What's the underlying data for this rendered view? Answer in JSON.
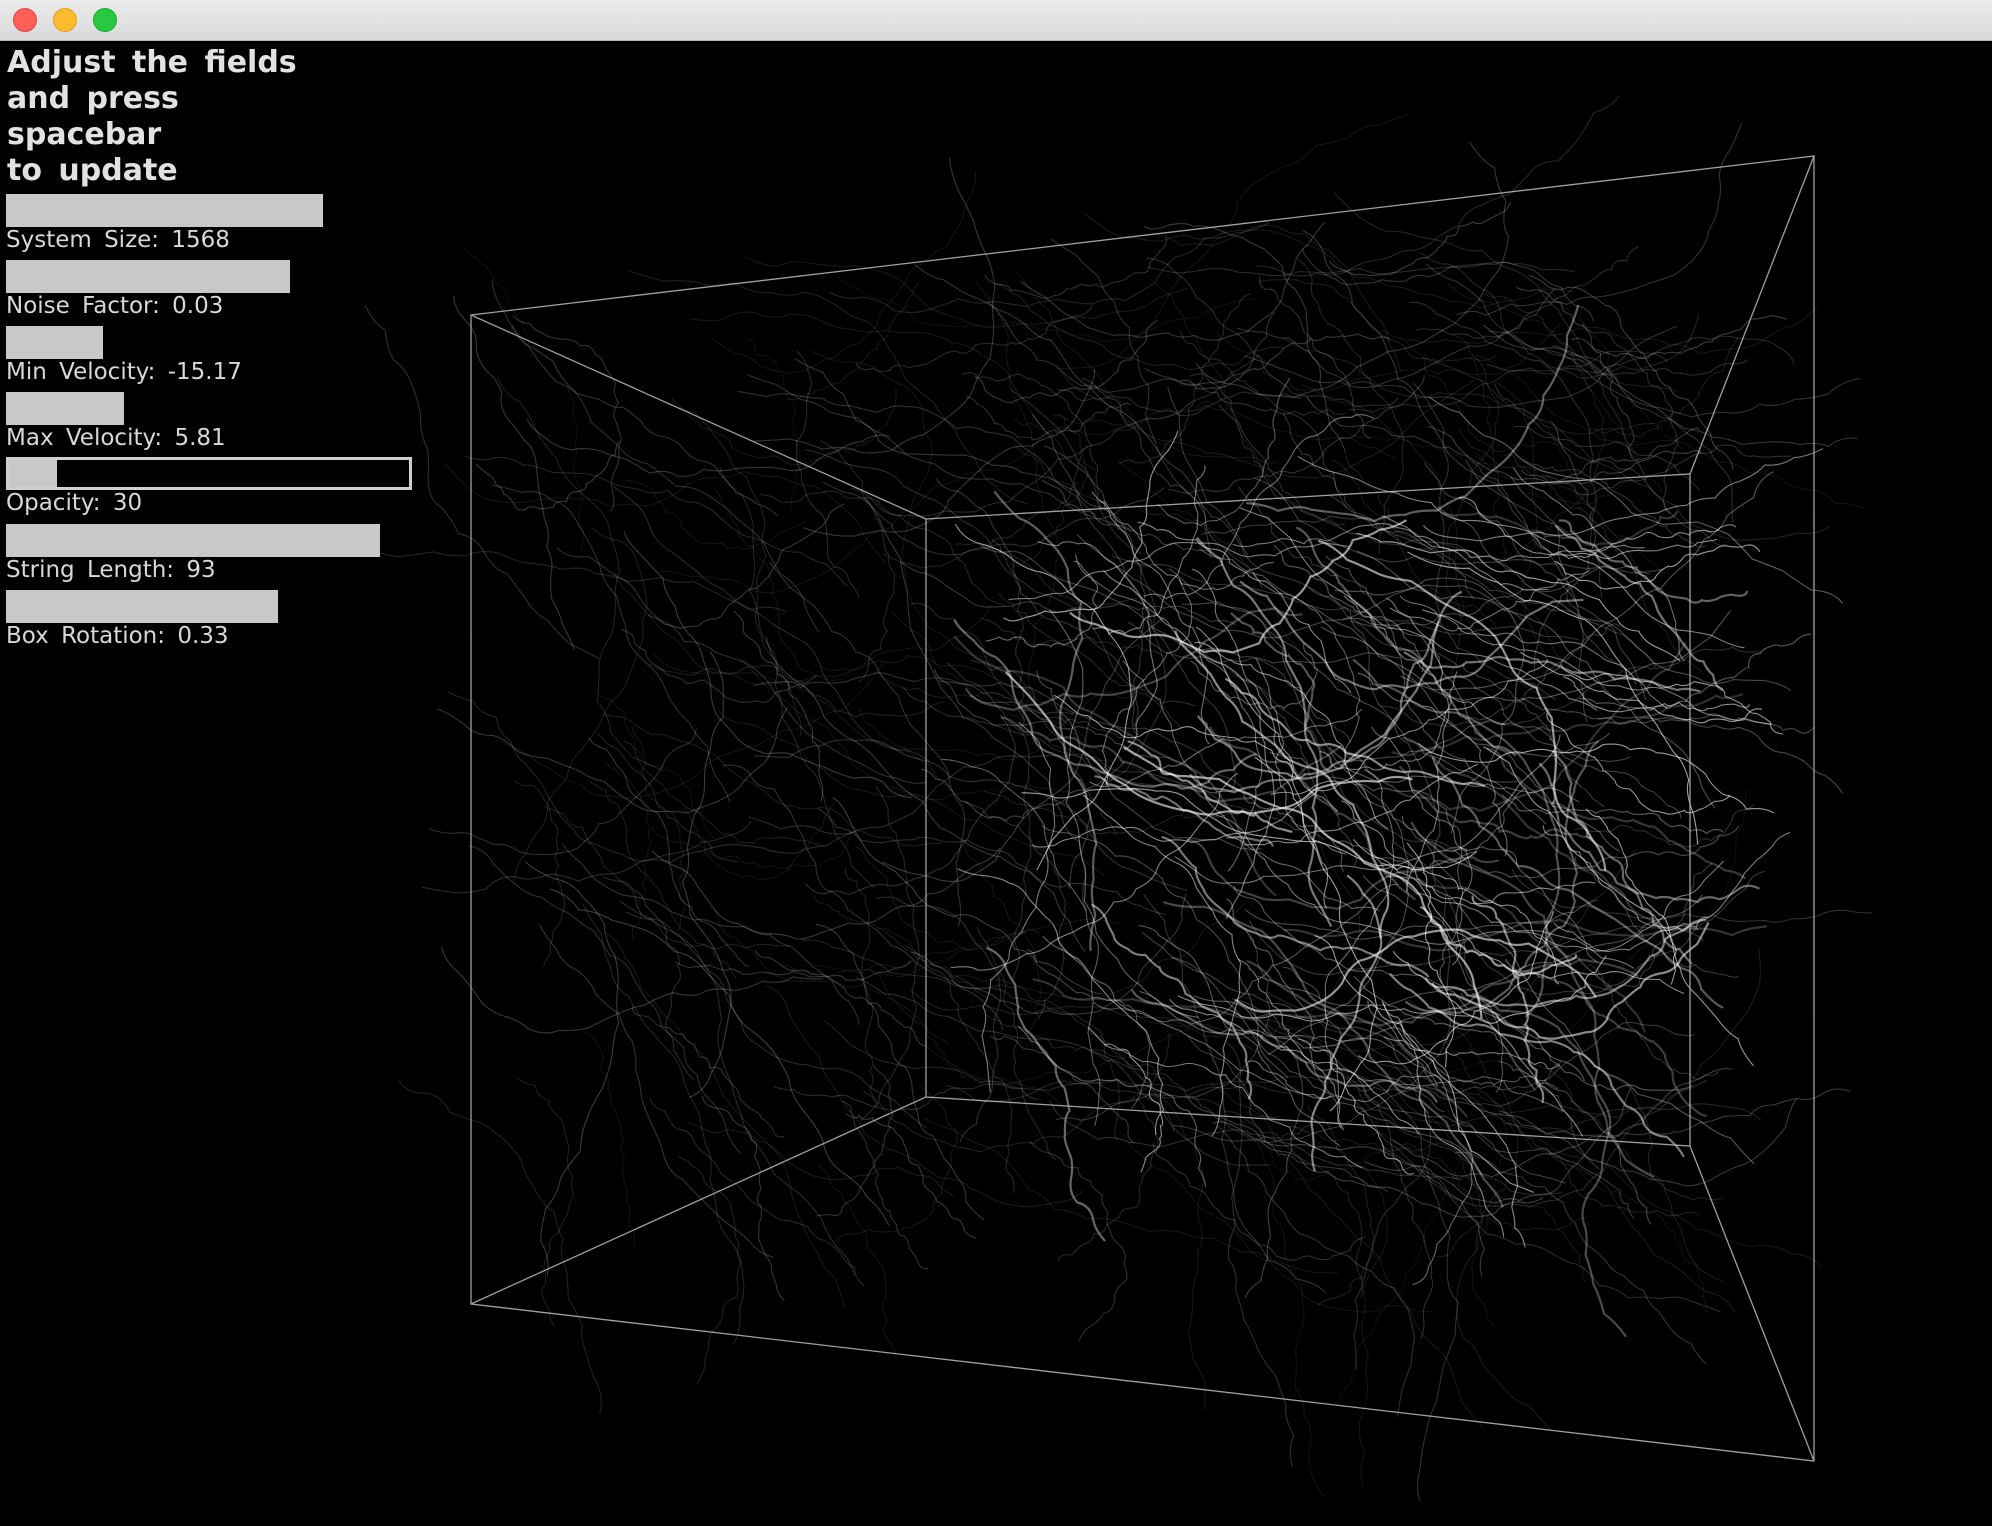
{
  "window": {
    "controls": [
      "close",
      "minimize",
      "maximize"
    ]
  },
  "instructions": "Adjust the fields\nand press spacebar\nto update",
  "sliders": [
    {
      "label": "System Size: 1568",
      "fill": 0.78,
      "focused": false
    },
    {
      "label": "Noise Factor: 0.03",
      "fill": 0.7,
      "focused": false
    },
    {
      "label": "Min Velocity: -15.17",
      "fill": 0.24,
      "focused": false
    },
    {
      "label": "Max Velocity: 5.81",
      "fill": 0.29,
      "focused": false
    },
    {
      "label": "Opacity: 30",
      "fill": 0.12,
      "focused": true
    },
    {
      "label": "String Length: 93",
      "fill": 0.92,
      "focused": false
    },
    {
      "label": "Box Rotation: 0.33",
      "fill": 0.67,
      "focused": false
    }
  ],
  "colors": {
    "background": "#000000",
    "slider_fill": "#c8c8c8",
    "box_lines": "#bdbdbd",
    "strings": "#ffffff"
  }
}
